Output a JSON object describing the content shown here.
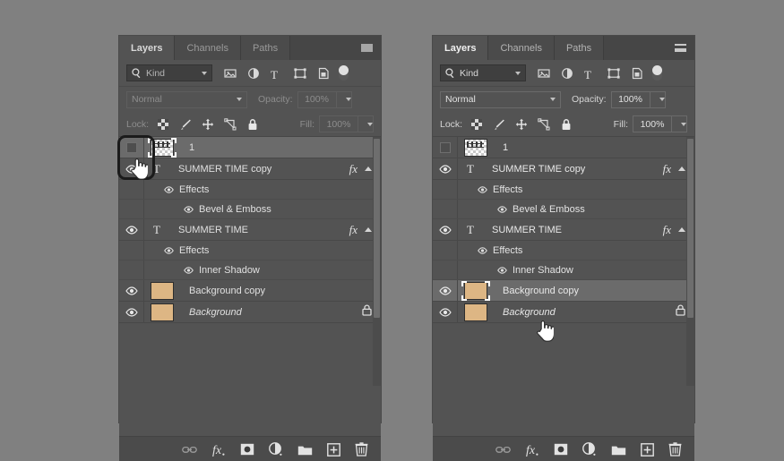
{
  "panels": [
    {
      "id": "left",
      "tabs": [
        {
          "label": "Layers",
          "active": true
        },
        {
          "label": "Channels",
          "active": false
        },
        {
          "label": "Paths",
          "active": false
        }
      ],
      "filter": {
        "kind_label": "Kind",
        "icons": [
          "pixel-layer-icon",
          "adjustment-layer-icon",
          "type-layer-icon",
          "shape-layer-icon",
          "smart-object-icon"
        ],
        "toggle": "filter-toggle"
      },
      "blend": {
        "mode": "Normal",
        "opacity_label": "Opacity:",
        "opacity_value": "100%"
      },
      "lock": {
        "label": "Lock:",
        "icons": [
          "lock-transparent-pixels-icon",
          "lock-image-pixels-icon",
          "lock-position-icon",
          "lock-artboard-icon",
          "lock-all-icon"
        ],
        "fill_label": "Fill:",
        "fill_value": "100%"
      },
      "layers": [
        {
          "type": "layer",
          "name": "1",
          "thumb": "checker",
          "visible": false,
          "selected": true,
          "thumb_selected": true,
          "fx": false,
          "locked": false,
          "italic": false
        },
        {
          "type": "layer",
          "name": "SUMMER TIME copy",
          "thumb": "type",
          "visible": true,
          "selected": false,
          "fx": true,
          "locked": false,
          "italic": false
        },
        {
          "type": "effects-group",
          "name": "Effects",
          "visible": true
        },
        {
          "type": "effect",
          "name": "Bevel & Emboss",
          "visible": true
        },
        {
          "type": "layer",
          "name": "SUMMER TIME",
          "thumb": "type",
          "visible": true,
          "selected": false,
          "fx": true,
          "locked": false,
          "italic": false
        },
        {
          "type": "effects-group",
          "name": "Effects",
          "visible": true
        },
        {
          "type": "effect",
          "name": "Inner Shadow",
          "visible": true
        },
        {
          "type": "layer",
          "name": "Background copy",
          "thumb": "tan",
          "visible": true,
          "selected": false,
          "fx": false,
          "locked": false,
          "italic": false
        },
        {
          "type": "layer",
          "name": "Background",
          "thumb": "tan",
          "visible": true,
          "selected": false,
          "fx": false,
          "locked": true,
          "italic": true
        }
      ],
      "footer_icons": [
        "link-layers-icon",
        "add-layer-style-icon",
        "add-layer-mask-icon",
        "new-adjustment-layer-icon",
        "new-group-icon",
        "new-layer-icon",
        "delete-layer-icon"
      ]
    },
    {
      "id": "right",
      "tabs": [
        {
          "label": "Layers",
          "active": true
        },
        {
          "label": "Channels",
          "active": false
        },
        {
          "label": "Paths",
          "active": false
        }
      ],
      "filter": {
        "kind_label": "Kind",
        "icons": [
          "pixel-layer-icon",
          "adjustment-layer-icon",
          "type-layer-icon",
          "shape-layer-icon",
          "smart-object-icon"
        ],
        "toggle": "filter-toggle"
      },
      "blend": {
        "mode": "Normal",
        "opacity_label": "Opacity:",
        "opacity_value": "100%"
      },
      "lock": {
        "label": "Lock:",
        "icons": [
          "lock-transparent-pixels-icon",
          "lock-image-pixels-icon",
          "lock-position-icon",
          "lock-artboard-icon",
          "lock-all-icon"
        ],
        "fill_label": "Fill:",
        "fill_value": "100%"
      },
      "layers": [
        {
          "type": "layer",
          "name": "1",
          "thumb": "checker",
          "visible": false,
          "selected": false,
          "thumb_selected": false,
          "fx": false,
          "locked": false,
          "italic": false
        },
        {
          "type": "layer",
          "name": "SUMMER TIME copy",
          "thumb": "type",
          "visible": true,
          "selected": false,
          "fx": true,
          "locked": false,
          "italic": false
        },
        {
          "type": "effects-group",
          "name": "Effects",
          "visible": true
        },
        {
          "type": "effect",
          "name": "Bevel & Emboss",
          "visible": true
        },
        {
          "type": "layer",
          "name": "SUMMER TIME",
          "thumb": "type",
          "visible": true,
          "selected": false,
          "fx": true,
          "locked": false,
          "italic": false
        },
        {
          "type": "effects-group",
          "name": "Effects",
          "visible": true
        },
        {
          "type": "effect",
          "name": "Inner Shadow",
          "visible": true
        },
        {
          "type": "layer",
          "name": "Background copy",
          "thumb": "tan",
          "visible": true,
          "selected": true,
          "thumb_selected": true,
          "fx": false,
          "locked": false,
          "italic": false
        },
        {
          "type": "layer",
          "name": "Background",
          "thumb": "tan",
          "visible": true,
          "selected": false,
          "fx": false,
          "locked": true,
          "italic": true
        }
      ],
      "footer_icons": [
        "link-layers-icon",
        "add-layer-style-icon",
        "add-layer-mask-icon",
        "new-adjustment-layer-icon",
        "new-group-icon",
        "new-layer-icon",
        "delete-layer-icon"
      ]
    }
  ],
  "annotations": {
    "highlight_box": "visibility-toggle-highlight",
    "cursor_left": "pointing-hand-cursor",
    "cursor_right": "pointing-hand-cursor"
  },
  "colors": {
    "page_background": "#808080",
    "panel_background": "#535353",
    "tabbar_background": "#464646",
    "row_selected": "#6b6b6b",
    "thumbnail_tan": "#ddb684",
    "annotation_stroke": "#1b1b1b",
    "text_primary": "#e8e8e8"
  }
}
